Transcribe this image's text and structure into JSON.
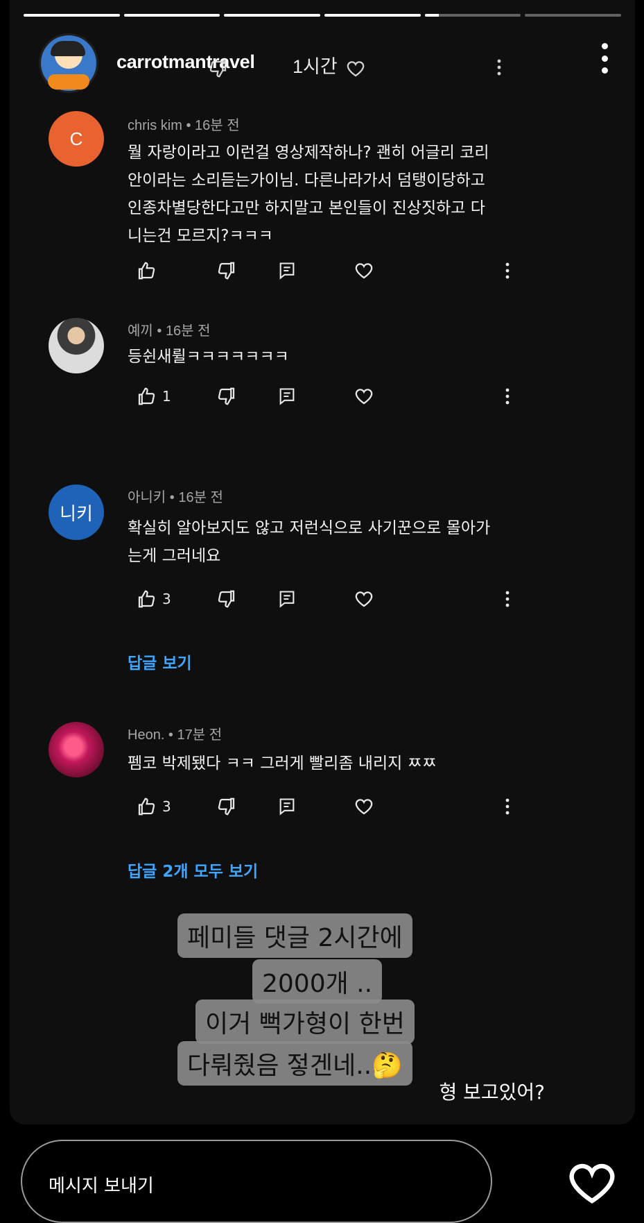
{
  "story": {
    "progress": [
      1,
      1,
      1,
      1,
      0.15,
      0
    ],
    "username": "carrotmantravel",
    "time": "1시간"
  },
  "comments": [
    {
      "author": "chris kim",
      "time": "16분 전",
      "avatar_initial": "C",
      "avatar_color": "#e8632f",
      "text_lines": [
        "뭘 자랑이라고 이런걸 영상제작하나? 괜히 어글리 코리",
        "안이라는 소리듣는가이님. 다른나라가서 덤탱이당하고",
        "인종차별당한다고만 하지말고 본인들이 진상짓하고 다",
        "니는건 모르지?ㅋㅋㅋ"
      ],
      "likes": ""
    },
    {
      "author": "예끼",
      "time": "16분 전",
      "avatar_initial": "",
      "avatar_color": "#cfcfcf",
      "text_lines": [
        "등쉰새륄ㅋㅋㅋㅋㅋㅋㅋ"
      ],
      "likes": "1"
    },
    {
      "author": "아니키",
      "time": "16분 전",
      "avatar_initial": "니키",
      "avatar_color": "#1e63b8",
      "text_lines": [
        "확실히 알아보지도 않고 저런식으로 사기꾼으로 몰아가",
        "는게 그러네요"
      ],
      "likes": "3",
      "replies": "답글 보기"
    },
    {
      "author": "Heon.",
      "time": "17분 전",
      "avatar_initial": "",
      "avatar_color": "#c2185b",
      "text_lines": [
        "펨코 박제됐다 ㅋㅋ 그러게 빨리좀 내리지 ㅉㅉ"
      ],
      "likes": "3",
      "replies": "답글 2개 모두 보기"
    }
  ],
  "overlay": {
    "sticker_lines": [
      "페미들 댓글 2시간에",
      "2000개 ..",
      "이거 뻑가형이 한번",
      "다뤄줬음 젛겐네..🤔"
    ],
    "caption": "형 보고있어?"
  },
  "footer": {
    "message_placeholder": "메시지 보내기"
  },
  "colors": {
    "background": "#0f0f0f",
    "link": "#3ea6ff",
    "sticker_bg": "#8c8c8c"
  }
}
